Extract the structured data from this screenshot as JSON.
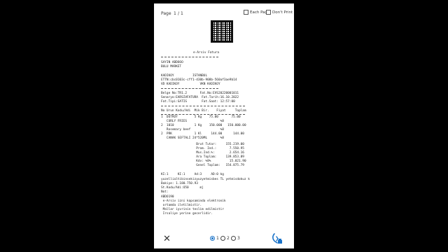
{
  "top": {
    "page_label": "Page",
    "page_current": "1",
    "page_sep": "/",
    "page_total": "1",
    "each_page_label": "Each Page",
    "dont_print_label": "Don't Print"
  },
  "receipt": {
    "title": "e-Arsiv Fatura",
    "lines": [
      "SAYIN ABDOOO",
      "BULU MARKET",
      "KADIKOY          ISTANBUL",
      "ETTN:cbc0103c-cff1-430b-908b-560af3ae9b14",
      "VD KADIKOY           VKN KADIKOY",
      "Belge No:TR1.2       Fat.No:EVS20220001011",
      "Senaryo:EARSIVFATURA  Fat.Tarih:16.10.2022",
      "Fat.Tipi:SATIS        Fat.Saat: 12:57:00",
      "No Urun Kodu/Adi  Mik Bir.    Fiyat     Toplam",
      "1  DOTROY         5 Kg    75.00       75.00",
      "   CURLY FRIES                  %8",
      "2  1010           1 Kg    150.000   150.000.00",
      "   Rosemary beef                %8",
      "2  PRK            1 Kl     144.00      144.00",
      "   CANAK SEFTALI 24*520ML       %8",
      "                   Brut Tutar:     155.219.00",
      "                   Prom. Ind.:       7.550.95",
      "                   Mus.Ind.%:        2.654.16",
      "                   Ara Toplam:     139.853.89",
      "                   Kdv: %8%          15.021.90",
      "                   Genel Toplam:   154.875.79",
      "KI:1     KI:1     Ad:3     AD:0 kg",
      "yuzellialtibinsekizyuzyetmisbes TL yetmisdokuz k",
      "Bakiye: 1.180.750.93",
      "St.Kodu/Adi:O50      mj",
      "Not:",
      "ABDO190",
      " e-Arsiv izni kapsaminda elektronik",
      " ortamda iletilmistir.",
      " Mallar iyvrinin teslim edilmistir",
      " Irsaliye yerine gecerlidir."
    ]
  },
  "bottom": {
    "options": [
      "1",
      "2",
      "3"
    ],
    "selected": "1"
  },
  "colors": {
    "accent": "#1a73c9",
    "backdrop": "#000000",
    "panel": "#ffffff"
  },
  "icons": {
    "close": "close-icon",
    "print": "print-icon"
  }
}
